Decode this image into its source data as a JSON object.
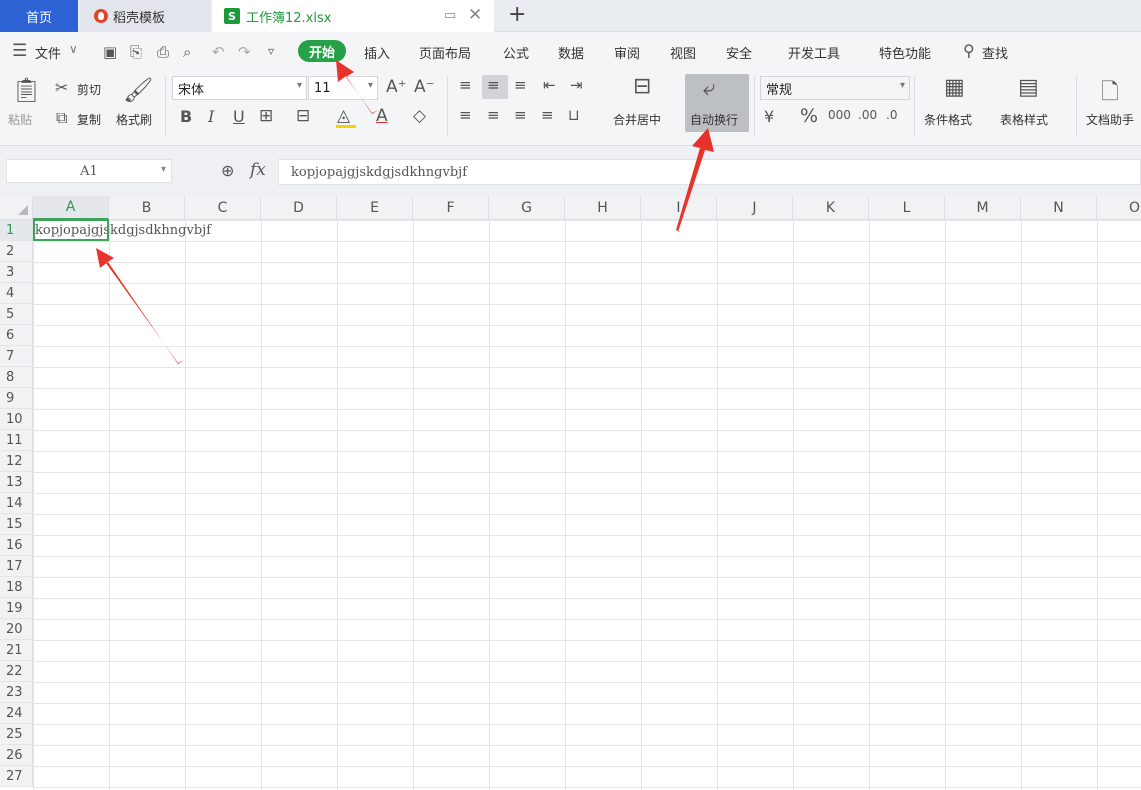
{
  "tabs": {
    "home": "首页",
    "daoke": "稻壳模板",
    "workbook": "工作簿12.xlsx",
    "workbook_icon_letter": "S"
  },
  "menu": {
    "file": "文件",
    "start": "开始",
    "insert": "插入",
    "page_layout": "页面布局",
    "formula": "公式",
    "data": "数据",
    "review": "审阅",
    "view": "视图",
    "security": "安全",
    "dev_tools": "开发工具",
    "special": "特色功能",
    "search": "查找"
  },
  "ribbon": {
    "paste": "粘贴",
    "cut": "剪切",
    "copy": "复制",
    "format_painter": "格式刷",
    "font_name": "宋体",
    "font_size": "11",
    "merge_center": "合并居中",
    "auto_wrap": "自动换行",
    "number_format": "常规",
    "cond_format": "条件格式",
    "table_style": "表格样式",
    "doc_assistant": "文档助手"
  },
  "formula_bar": {
    "cell_ref": "A1",
    "fx": "fx",
    "content": "kopjopajgjskdgjsdkhngvbjf"
  },
  "grid": {
    "columns": [
      "A",
      "B",
      "C",
      "D",
      "E",
      "F",
      "G",
      "H",
      "I",
      "J",
      "K",
      "L",
      "M",
      "N",
      "O"
    ],
    "rows": [
      "1",
      "2",
      "3",
      "4",
      "5",
      "6",
      "7",
      "8",
      "9",
      "10",
      "11",
      "12",
      "13",
      "14",
      "15",
      "16",
      "17",
      "18",
      "19",
      "20",
      "21",
      "22",
      "23",
      "24",
      "25",
      "26",
      "27"
    ],
    "cell_a1": "kopjopajgjskdgjsdkhngvbjf"
  },
  "colors": {
    "accent_green": "#27a04a",
    "home_tab_blue": "#2e63d6",
    "arrow_red": "#e8332b"
  }
}
